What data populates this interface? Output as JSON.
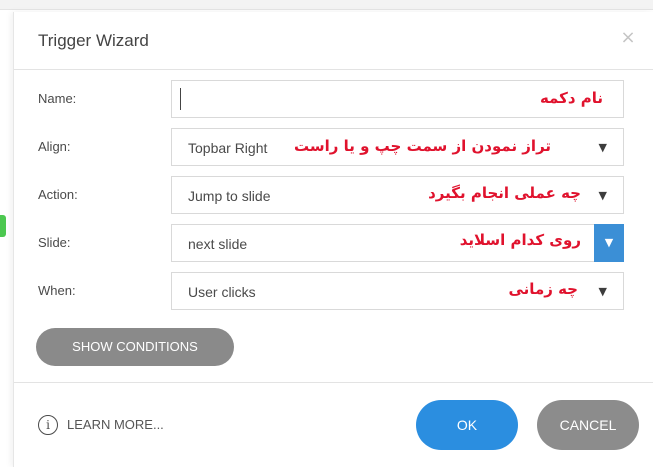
{
  "dialog": {
    "title": "Trigger Wizard",
    "close_glyph": "×"
  },
  "fields": {
    "name": {
      "label": "Name:",
      "value": "",
      "note": "نام دکمه"
    },
    "align": {
      "label": "Align:",
      "value": "Topbar Right",
      "note": "تراز نمودن از سمت چپ و یا راست",
      "caret": "▼"
    },
    "action": {
      "label": "Action:",
      "value": "Jump to slide",
      "note": "چه عملی انجام بگیرد",
      "caret": "▼"
    },
    "slide": {
      "label": "Slide:",
      "value": "next slide",
      "note": "روی کدام اسلاید",
      "caret": "▼"
    },
    "when": {
      "label": "When:",
      "value": "User clicks",
      "note": "چه زمانی",
      "caret": "▼"
    }
  },
  "buttons": {
    "show_conditions": "SHOW CONDITIONS",
    "learn_more": "LEARN MORE...",
    "info_glyph": "i",
    "ok": "OK",
    "cancel": "CANCEL"
  },
  "colors": {
    "annotation": "#e0122d",
    "primary": "#2b8ee0",
    "slide_dropdown": "#3b8fd6",
    "secondary": "#8c8c8c"
  }
}
